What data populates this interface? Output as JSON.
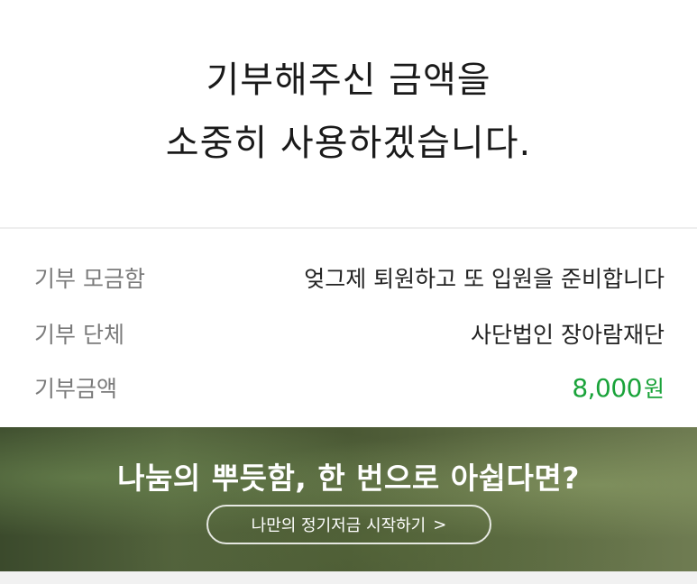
{
  "hero": {
    "line1": "기부해주신 금액을",
    "line2": "소중히 사용하겠습니다."
  },
  "details": [
    {
      "label": "기부 모금함",
      "value": "엊그제 퇴원하고 또 입원을 준비합니다"
    },
    {
      "label": "기부 단체",
      "value": "사단법인 장아람재단"
    },
    {
      "label": "기부금액",
      "amount": "8,000",
      "unit": "원"
    }
  ],
  "banner": {
    "title": "나눔의 뿌듯함, 한 번으로 아쉽다면?",
    "cta_label": "나만의 정기저금 시작하기",
    "cta_chevron": ">"
  },
  "colors": {
    "amount": "#1aa33a",
    "label_gray": "#7b7b7b"
  }
}
